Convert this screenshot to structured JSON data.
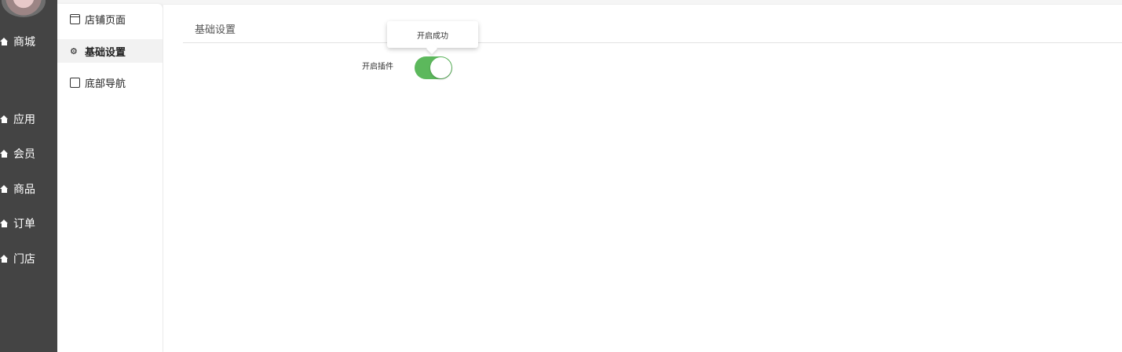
{
  "leftnav": {
    "items": [
      {
        "label": "商城",
        "icon": "home-icon"
      },
      {
        "label": "应用",
        "icon": "home-icon"
      },
      {
        "label": "会员",
        "icon": "home-icon"
      },
      {
        "label": "商品",
        "icon": "home-icon"
      },
      {
        "label": "订单",
        "icon": "home-icon"
      },
      {
        "label": "门店",
        "icon": "home-icon"
      }
    ]
  },
  "subnav": {
    "items": [
      {
        "label": "店铺页面",
        "icon": "window-icon",
        "active": false
      },
      {
        "label": "基础设置",
        "icon": "gears-icon",
        "active": true
      },
      {
        "label": "底部导航",
        "icon": "tablet-icon",
        "active": false
      }
    ]
  },
  "main": {
    "tab_label": "基础设置",
    "form": {
      "plugin_label": "开启插件",
      "plugin_enabled": true
    },
    "tooltip": "开启成功"
  },
  "colors": {
    "sidebar_bg": "#444444",
    "switch_on": "#5cb85c",
    "active_item_bg": "#f2f2f2"
  }
}
